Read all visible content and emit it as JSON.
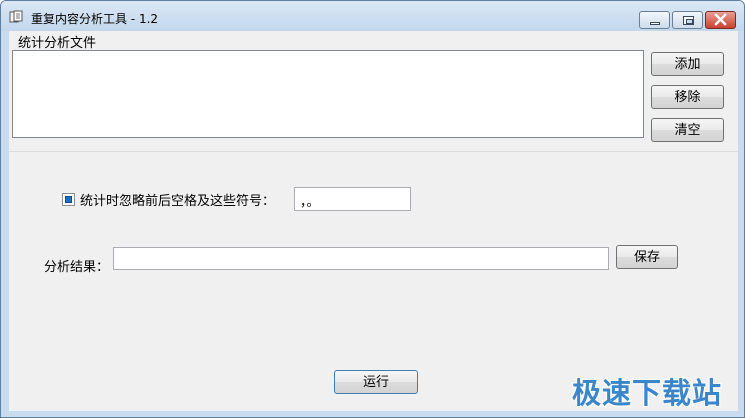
{
  "window": {
    "title": "重复内容分析工具 - 1.2",
    "icon": "app-icon",
    "controls": {
      "minimize": "minimize-icon",
      "maximize": "maximize-icon",
      "close": "close-icon"
    }
  },
  "files_group": {
    "label": "统计分析文件",
    "buttons": {
      "add": "添加",
      "remove": "移除",
      "clear": "清空"
    }
  },
  "options": {
    "ignore_checkbox_label": "统计时忽略前后空格及这些符号：",
    "ignore_checked": true,
    "symbols_value": "，。"
  },
  "result": {
    "label": "分析结果：",
    "value": "",
    "save_label": "保存"
  },
  "run_label": "运行",
  "watermark": "极速下载站",
  "colors": {
    "accent": "#3a86c8",
    "close": "#c9412d",
    "titlebar": "#c9dcef"
  }
}
